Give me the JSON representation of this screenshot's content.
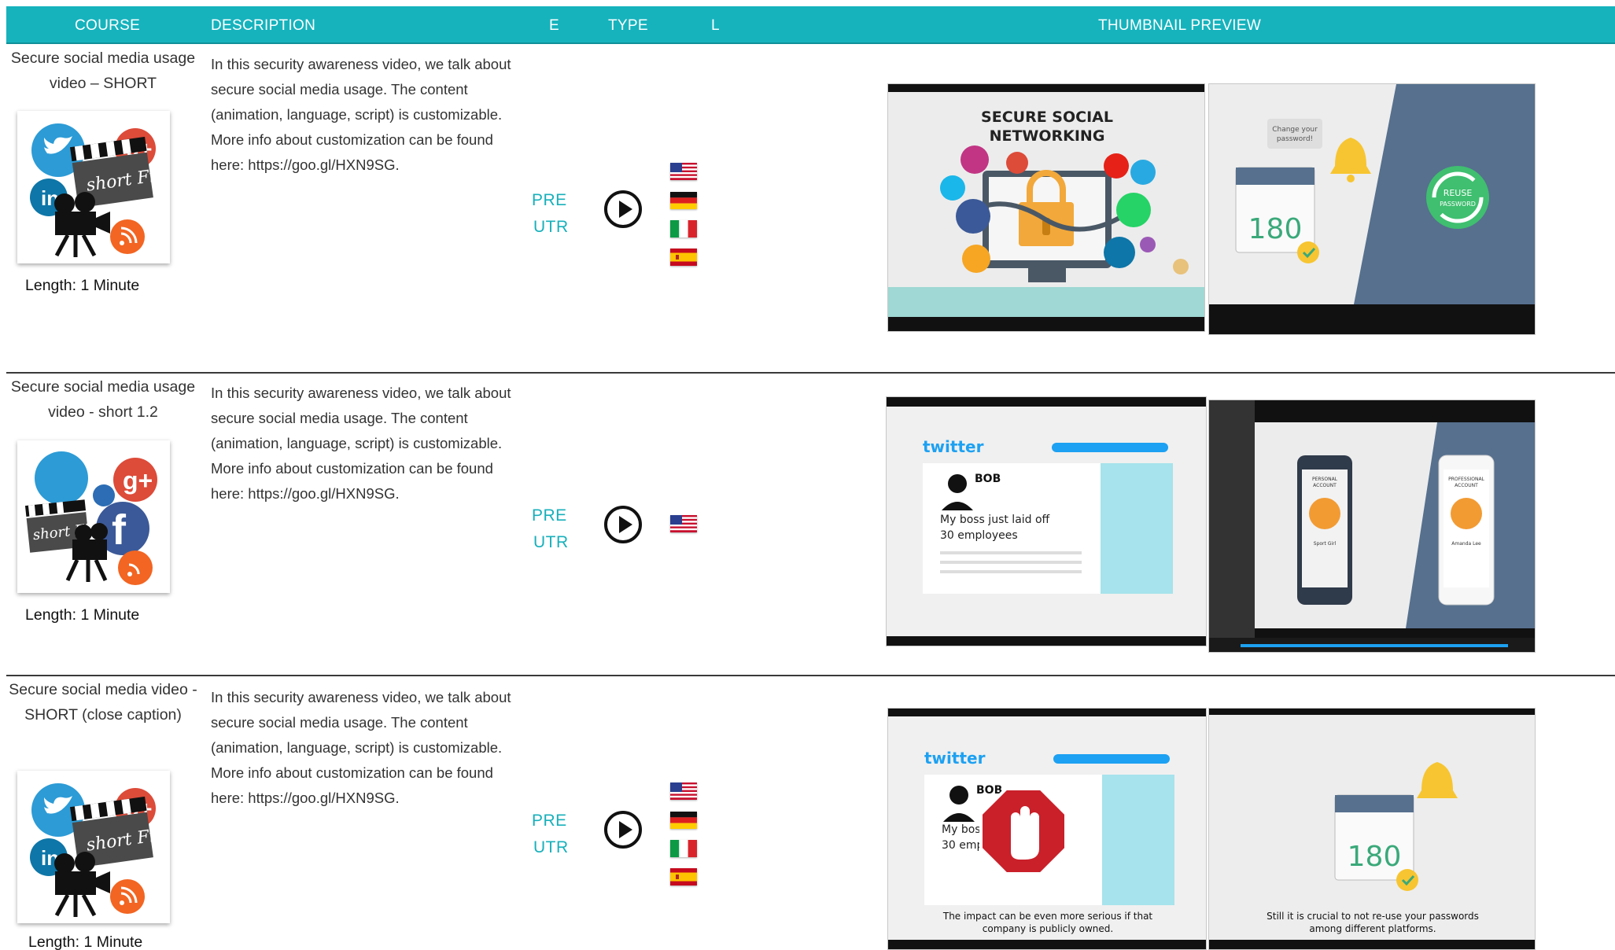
{
  "header": {
    "course": "COURSE",
    "description": "DESCRIPTION",
    "e": "E",
    "type": "TYPE",
    "l": "L",
    "preview": "THUMBNAIL PREVIEW"
  },
  "colors": {
    "header_bg": "#16b3bd",
    "type_text": "#17b0bb"
  },
  "rows": [
    {
      "title": "Secure social media usage video – SHORT",
      "description": "In this security awareness video, we talk about secure social media usage. The content (animation, language, script) is customizable. More info about customization can be found here: https://goo.gl/HXN9SG.",
      "type_1": "PRE",
      "type_2": "UTR",
      "length": "Length: 1 Minute",
      "flags": [
        "us-flag-icon",
        "de-flag-icon",
        "it-flag-icon",
        "es-flag-icon"
      ],
      "preview_a": {
        "heading_1": "SECURE SOCIAL",
        "heading_2": "NETWORKING"
      },
      "preview_b": {
        "bubble_1": "Change your",
        "bubble_2": "password!",
        "calendar_number": "180",
        "badge_1": "REUSE",
        "badge_2": "PASSWORD"
      }
    },
    {
      "title": "Secure social media usage video - short 1.2",
      "description": "In this security awareness video, we talk about secure social media usage. The content (animation, language, script) is customizable. More info about customization can be found here: https://goo.gl/HXN9SG.",
      "type_1": "PRE",
      "type_2": "UTR",
      "length": "Length: 1 Minute",
      "flags": [
        "us-flag-icon"
      ],
      "preview_a": {
        "brand": "twitter",
        "name": "BOB",
        "post_1": "My boss just laid off",
        "post_2": "30 employees"
      },
      "preview_b": {
        "phone_1_1": "PERSONAL",
        "phone_1_2": "ACCOUNT",
        "phone_1_name": "Sport Girl",
        "phone_2_1": "PROFESSIONAL",
        "phone_2_2": "ACCOUNT",
        "phone_2_name": "Amanda Lee"
      }
    },
    {
      "title": "Secure social media video - SHORT (close caption)",
      "description": "In this security awareness video, we talk about secure social media usage. The content (animation, language, script) is customizable. More info about customization can be found here: https://goo.gl/HXN9SG.",
      "type_1": "PRE",
      "type_2": "UTR",
      "length": "Length: 1 Minute",
      "flags": [
        "us-flag-icon",
        "de-flag-icon",
        "it-flag-icon",
        "es-flag-icon"
      ],
      "preview_a": {
        "brand": "twitter",
        "name": "BOB",
        "post_1": "My boss just",
        "post_2": "30 employee",
        "caption_1": "The impact can be even more serious if that",
        "caption_2": "company is publicly owned."
      },
      "preview_b": {
        "calendar_number": "180",
        "caption_1": "Still it is crucial to not re-use your passwords",
        "caption_2": "among different platforms."
      }
    }
  ]
}
